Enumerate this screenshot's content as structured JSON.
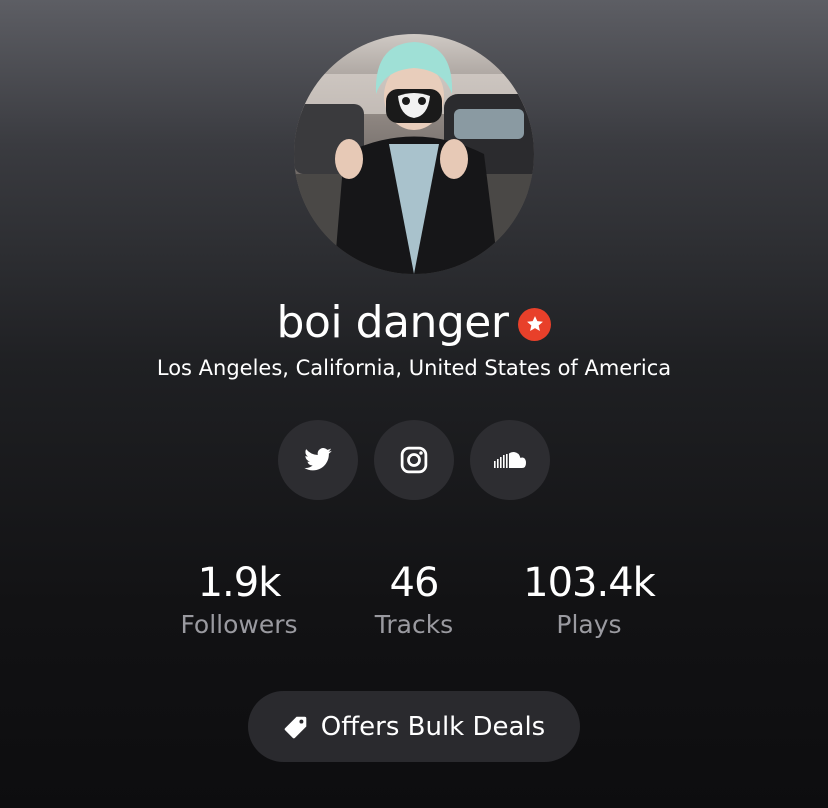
{
  "profile": {
    "name": "boi danger",
    "location": "Los Angeles, California, United States of America",
    "avatar_icon": "profile-photo",
    "verified_icon": "star-badge-icon",
    "verified_color": "#e8402a"
  },
  "socials": [
    {
      "name": "twitter",
      "icon": "twitter-icon"
    },
    {
      "name": "instagram",
      "icon": "instagram-icon"
    },
    {
      "name": "soundcloud",
      "icon": "soundcloud-icon"
    }
  ],
  "stats": {
    "followers": {
      "value": "1.9k",
      "label": "Followers"
    },
    "tracks": {
      "value": "46",
      "label": "Tracks"
    },
    "plays": {
      "value": "103.4k",
      "label": "Plays"
    }
  },
  "offers": {
    "label": "Offers Bulk Deals",
    "icon": "tag-icon"
  },
  "colors": {
    "button_bg": "#2d2d31",
    "secondary_text": "#9a9aa0"
  }
}
